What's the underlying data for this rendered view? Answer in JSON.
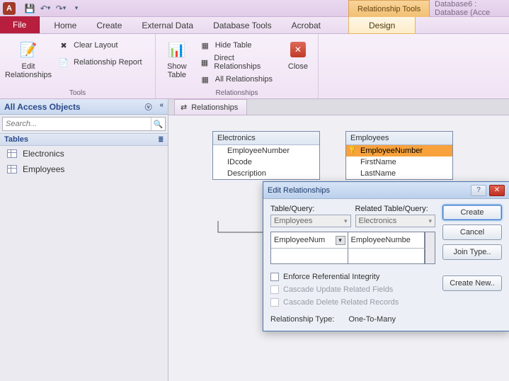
{
  "titlebar": {
    "context_tools": "Relationship Tools",
    "database_name": "Database6 : Database (Acce",
    "app_letter": "A"
  },
  "tabs": {
    "file": "File",
    "home": "Home",
    "create": "Create",
    "external": "External Data",
    "dbtools": "Database Tools",
    "acrobat": "Acrobat",
    "design": "Design"
  },
  "ribbon": {
    "tools_group": "Tools",
    "relationships_group": "Relationships",
    "edit_rel": "Edit\nRelationships",
    "clear_layout": "Clear Layout",
    "rel_report": "Relationship Report",
    "show_table": "Show\nTable",
    "hide_table": "Hide Table",
    "direct_rel": "Direct Relationships",
    "all_rel": "All Relationships",
    "close": "Close"
  },
  "nav": {
    "header": "All Access Objects",
    "search_placeholder": "Search...",
    "section_tables": "Tables",
    "items": [
      "Electronics",
      "Employees"
    ]
  },
  "doc_tab": "Relationships",
  "tables": {
    "electronics": {
      "title": "Electronics",
      "fields": [
        "EmployeeNumber",
        "IDcode",
        "Description"
      ]
    },
    "employees": {
      "title": "Employees",
      "fields": [
        "EmployeeNumber",
        "FirstName",
        "LastName"
      ],
      "key_field_index": 0,
      "selected_field_index": 0
    }
  },
  "dialog": {
    "title": "Edit Relationships",
    "table_query": "Table/Query:",
    "related_tq": "Related Table/Query:",
    "left_combo": "Employees",
    "right_combo": "Electronics",
    "left_field": "EmployeeNum",
    "right_field": "EmployeeNumbe",
    "enforce": "Enforce Referential Integrity",
    "cascade_update": "Cascade Update Related Fields",
    "cascade_delete": "Cascade Delete Related Records",
    "rel_type_label": "Relationship Type:",
    "rel_type_value": "One-To-Many",
    "btn_create": "Create",
    "btn_cancel": "Cancel",
    "btn_join": "Join Type..",
    "btn_new": "Create New.."
  }
}
